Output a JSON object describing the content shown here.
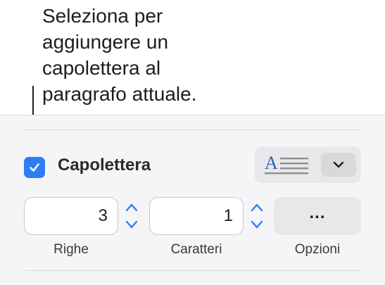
{
  "callout": {
    "text": "Seleziona per\naggiungere un\ncapolettera al\nparagrafo attuale."
  },
  "drop_cap": {
    "checkbox_label": "Capolettera",
    "checked": true,
    "style_preview_icon": "dropcap-style-icon",
    "dropdown_icon": "chevron-down-icon"
  },
  "fields": {
    "lines": {
      "value": "3",
      "caption": "Righe"
    },
    "characters": {
      "value": "1",
      "caption": "Caratteri"
    }
  },
  "options": {
    "button_label": "...",
    "caption": "Opzioni"
  },
  "colors": {
    "accent": "#2f7df6",
    "preview_blue": "#2f5fb8"
  }
}
